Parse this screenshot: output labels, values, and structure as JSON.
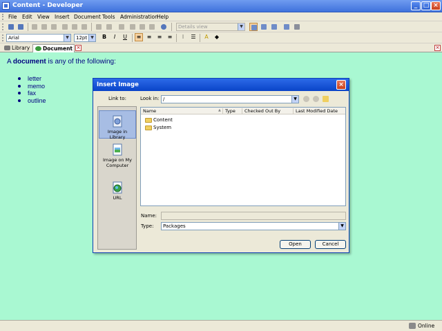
{
  "window": {
    "title": "Content - Developer"
  },
  "menu": [
    "File",
    "Edit",
    "View",
    "Insert",
    "Document",
    "Tools",
    "Administration",
    "Help"
  ],
  "toolbar": {
    "view_select": "Details view"
  },
  "format": {
    "font": "Arial",
    "size": "12pt",
    "bold": "B",
    "italic": "I",
    "underline": "U"
  },
  "tabs": [
    {
      "label": "Library",
      "active": false
    },
    {
      "label": "Document",
      "active": true
    }
  ],
  "document": {
    "heading_prefix": "A",
    "heading_bold": "document",
    "heading_suffix": "is any of the following:",
    "items": [
      "letter",
      "memo",
      "fax",
      "outline"
    ]
  },
  "dialog": {
    "title": "Insert Image",
    "link_to_label": "Link to:",
    "look_in_label": "Look in:",
    "look_in_value": "/",
    "link_options": [
      {
        "label": "Image in Library",
        "icon": "library-icon",
        "selected": true
      },
      {
        "label": "Image on My Computer",
        "icon": "computer-image-icon",
        "selected": false
      },
      {
        "label": "URL",
        "icon": "globe-icon",
        "selected": false
      }
    ],
    "columns": [
      "Name",
      "Type",
      "Checked Out By",
      "Last Modified Date"
    ],
    "files": [
      {
        "name": "Content",
        "icon": "folder-icon"
      },
      {
        "name": "System",
        "icon": "folder-icon"
      }
    ],
    "name_label": "Name:",
    "name_value": "",
    "type_label": "Type:",
    "type_value": "Packages",
    "open_label": "Open",
    "cancel_label": "Cancel"
  },
  "status": {
    "online": "Online"
  },
  "colors": {
    "document_bg": "#a9f8d2",
    "titlebar": "#3f72dc",
    "text_navy": "#000080"
  }
}
